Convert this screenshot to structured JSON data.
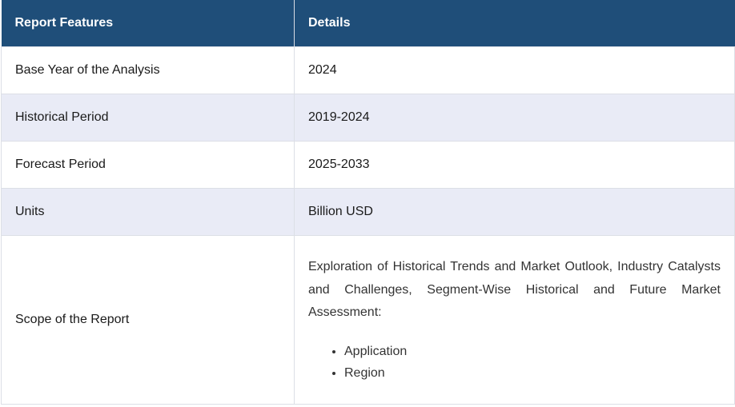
{
  "header": {
    "col1": "Report Features",
    "col2": "Details"
  },
  "rows": [
    {
      "feature": "Base Year of the Analysis",
      "detail": "2024"
    },
    {
      "feature": "Historical Period",
      "detail": "2019-2024"
    },
    {
      "feature": "Forecast Period",
      "detail": "2025-2033"
    },
    {
      "feature": "Units",
      "detail": "Billion USD"
    }
  ],
  "scope": {
    "feature": "Scope of the Report",
    "description": "Exploration of Historical Trends and Market Outlook, Industry Catalysts and Challenges, Segment-Wise Historical and Future Market Assessment:",
    "items": [
      "Application",
      "Region"
    ]
  },
  "colors": {
    "header_bg": "#1f4e79",
    "shaded_row_bg": "#e9ebf6",
    "border": "#dcdfe6"
  }
}
